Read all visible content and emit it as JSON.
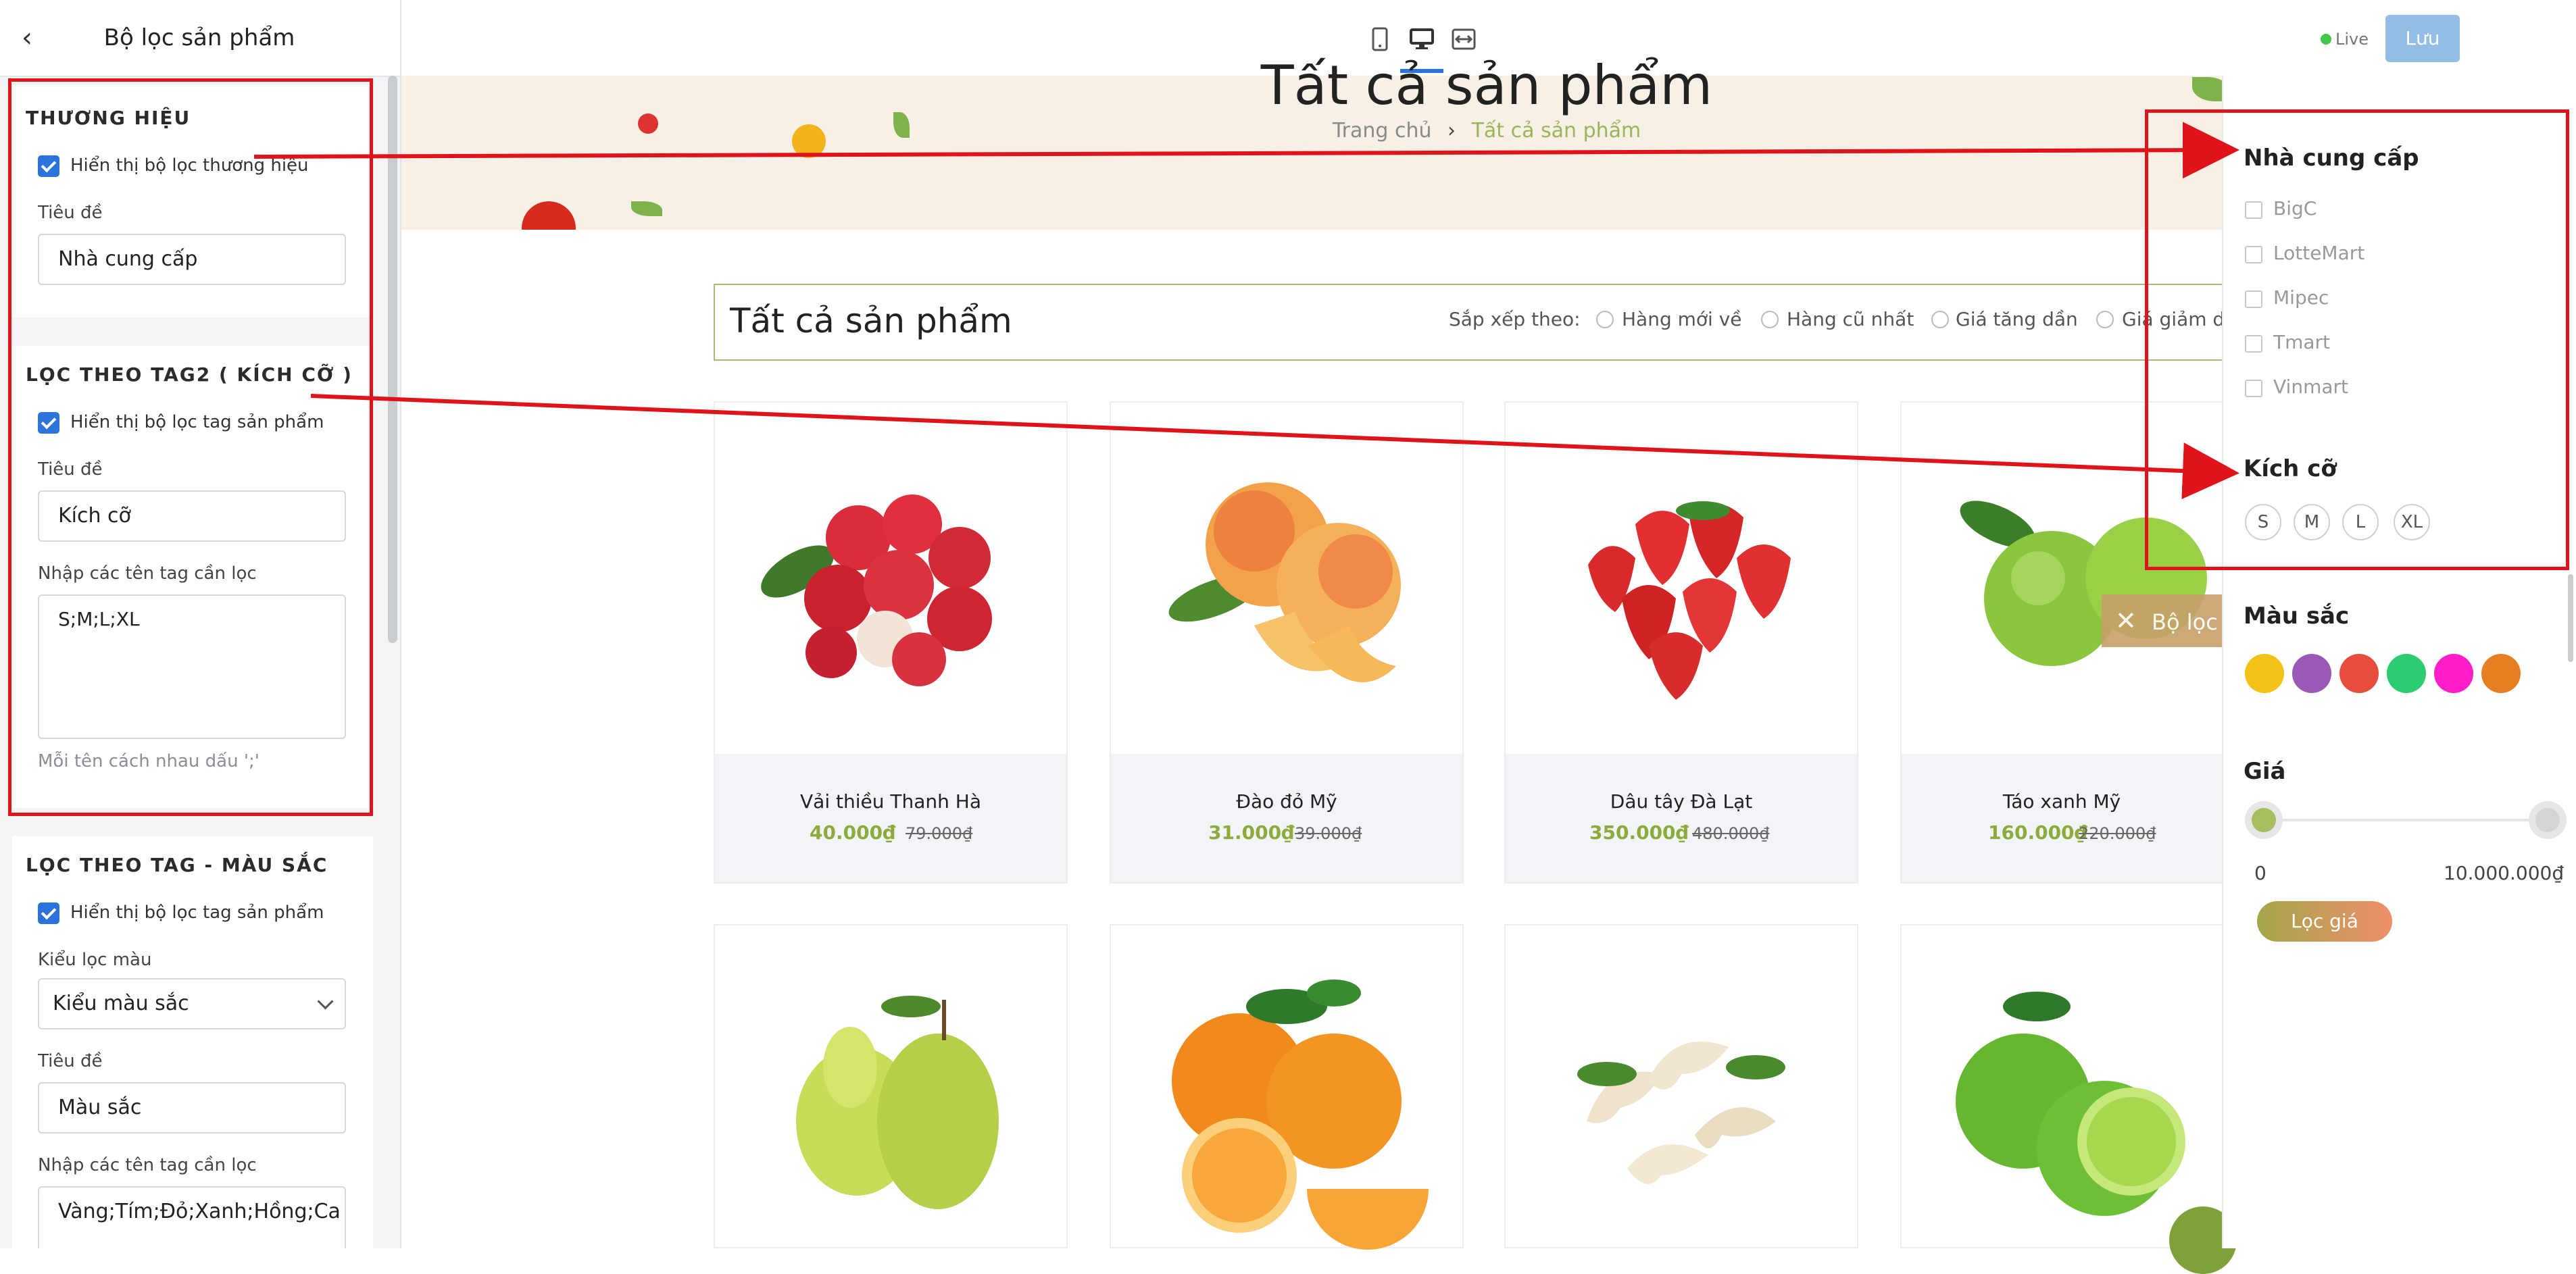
{
  "sidebar": {
    "title": "Bộ lọc sản phẩm",
    "sections": {
      "brand": {
        "title": "THƯƠNG HIỆU",
        "checkbox_label": "Hiển thị bộ lọc thương hiệu",
        "title_label": "Tiêu đề",
        "title_value": "Nhà cung cấp"
      },
      "tag2": {
        "title": "LỌC THEO TAG2 ( KÍCH CỠ )",
        "checkbox_label": "Hiển thị bộ lọc tag sản phẩm",
        "title_label": "Tiêu đề",
        "title_value": "Kích cỡ",
        "tags_label": "Nhập các tên tag cần lọc",
        "tags_value": "S;M;L;XL",
        "hint": "Mỗi tên cách nhau dấu ';'"
      },
      "color": {
        "title": "LỌC THEO TAG - MÀU SẮC",
        "checkbox_label": "Hiển thị bộ lọc tag sản phẩm",
        "mode_label": "Kiểu lọc màu",
        "mode_value": "Kiểu màu sắc",
        "title_label": "Tiêu đề",
        "title_value": "Màu sắc",
        "tags_label": "Nhập các tên tag cần lọc",
        "tags_value": "Vàng;Tím;Đỏ;Xanh;Hồng;Ca"
      }
    }
  },
  "topbar": {
    "live_label": "Live",
    "save_label": "Lưu"
  },
  "preview": {
    "hero_title": "Tất cả sản phẩm",
    "breadcrumb_home": "Trang chủ",
    "breadcrumb_sep": "›",
    "breadcrumb_current": "Tất cả sản phẩm",
    "collection_title": "Tất cả sản phẩm",
    "sort_label": "Sắp xếp theo:",
    "sort_options": [
      "Hàng mới về",
      "Hàng cũ nhất",
      "Giá tăng dần",
      "Giá giảm dần"
    ],
    "close_filter_label": "Bộ lọc",
    "products": [
      {
        "name": "Vải thiều Thanh Hà",
        "price": "40.000₫",
        "old_price": "79.000₫"
      },
      {
        "name": "Đào đỏ Mỹ",
        "price": "31.000₫",
        "old_price": "39.000₫"
      },
      {
        "name": "Dâu tây Đà Lạt",
        "price": "350.000₫",
        "old_price": "480.000₫"
      },
      {
        "name": "Táo xanh Mỹ",
        "price": "160.000₫",
        "old_price": "220.000₫"
      }
    ]
  },
  "filter": {
    "supplier_title": "Nhà cung cấp",
    "suppliers": [
      "BigC",
      "LotteMart",
      "Mipec",
      "Tmart",
      "Vinmart"
    ],
    "size_title": "Kích cỡ",
    "sizes": [
      "S",
      "M",
      "L",
      "XL"
    ],
    "color_title": "Màu sắc",
    "colors": [
      "#f2c216",
      "#9b59b6",
      "#e74c3c",
      "#2ecc71",
      "#ff1ec8",
      "#e67e22"
    ],
    "price_title": "Giá",
    "price_min": "0",
    "price_max": "10.000.000₫",
    "price_button": "Lọc giá"
  }
}
